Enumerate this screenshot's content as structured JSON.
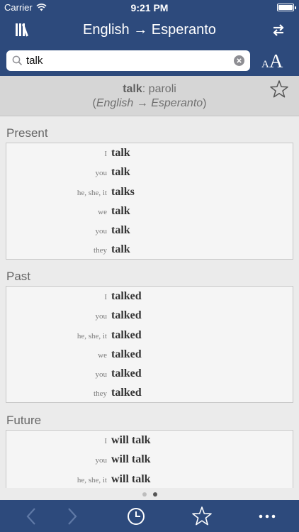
{
  "status_bar": {
    "carrier": "Carrier",
    "time": "9:21 PM"
  },
  "nav": {
    "title": "English → Esperanto",
    "left_icon": "library-icon",
    "right_icon": "swap-direction-icon"
  },
  "search": {
    "value": "talk",
    "placeholder": ""
  },
  "font_size_control": {
    "small": "A",
    "large": "A"
  },
  "result": {
    "word": "talk",
    "separator": ":",
    "translation": "paroli",
    "direction_open": "(",
    "source_lang": "English",
    "arrow": "→",
    "target_lang": "Esperanto",
    "direction_close": ")"
  },
  "conjugation": {
    "present": {
      "title": "Present",
      "rows": [
        {
          "pronoun": "I",
          "verb": "talk"
        },
        {
          "pronoun": "you",
          "verb": "talk"
        },
        {
          "pronoun": "he, she, it",
          "verb": "talks"
        },
        {
          "pronoun": "we",
          "verb": "talk"
        },
        {
          "pronoun": "you",
          "verb": "talk"
        },
        {
          "pronoun": "they",
          "verb": "talk"
        }
      ]
    },
    "past": {
      "title": "Past",
      "rows": [
        {
          "pronoun": "I",
          "verb": "talked"
        },
        {
          "pronoun": "you",
          "verb": "talked"
        },
        {
          "pronoun": "he, she, it",
          "verb": "talked"
        },
        {
          "pronoun": "we",
          "verb": "talked"
        },
        {
          "pronoun": "you",
          "verb": "talked"
        },
        {
          "pronoun": "they",
          "verb": "talked"
        }
      ]
    },
    "future": {
      "title": "Future",
      "rows": [
        {
          "pronoun": "I",
          "verb": "will talk"
        },
        {
          "pronoun": "you",
          "verb": "will talk"
        },
        {
          "pronoun": "he, she, it",
          "verb": "will talk"
        }
      ]
    }
  },
  "pager": {
    "pages": 2,
    "current": 2
  },
  "toolbar": {
    "icons": [
      "back-icon",
      "forward-icon",
      "history-icon",
      "favorites-icon",
      "more-icon"
    ]
  },
  "colors": {
    "brand": "#2d4a7c",
    "header_bg": "#d6d6d6",
    "page_bg": "#ebebeb"
  }
}
